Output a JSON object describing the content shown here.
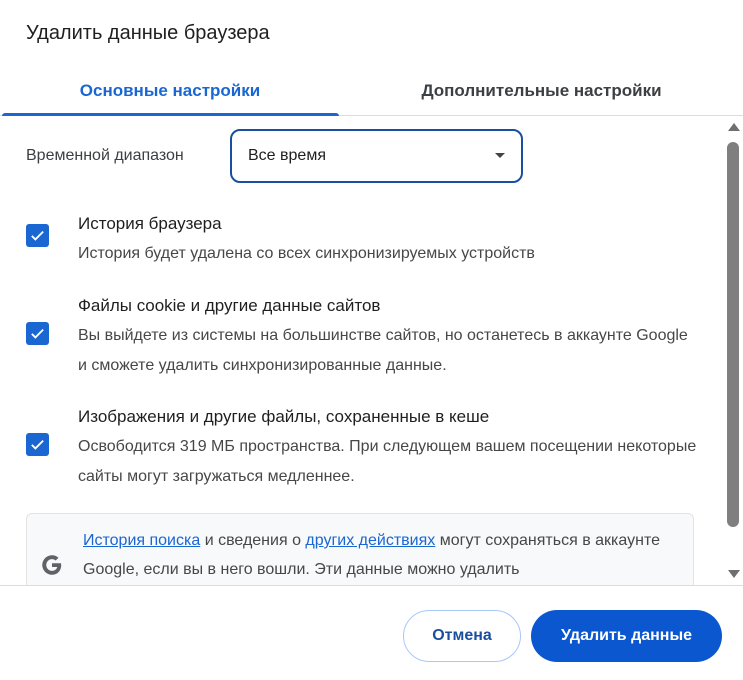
{
  "dialog": {
    "title": "Удалить данные браузера"
  },
  "tabs": [
    {
      "label": "Основные настройки",
      "active": true
    },
    {
      "label": "Дополнительные настройки",
      "active": false
    }
  ],
  "time_range": {
    "label": "Временной диапазон",
    "selected": "Все время"
  },
  "options": [
    {
      "title": "История браузера",
      "description": "История будет удалена со всех синхронизируемых устройств",
      "checked": true
    },
    {
      "title": "Файлы cookie и другие данные сайтов",
      "description": "Вы выйдете из системы на большинстве сайтов, но останетесь в аккаунте Google и сможете удалить синхронизированные данные.",
      "checked": true
    },
    {
      "title": "Изображения и другие файлы, сохраненные в кеше",
      "description": "Освободится 319 МБ пространства. При следующем вашем посещении некоторые сайты могут загружаться медленнее.",
      "checked": true
    }
  ],
  "info": {
    "link1": "История поиска",
    "text1": " и сведения о ",
    "link2": "других действиях",
    "text2": " могут сохраняться в аккаунте Google, если вы в него вошли. Эти данные можно удалить"
  },
  "buttons": {
    "cancel": "Отмена",
    "delete": "Удалить данные"
  },
  "colors": {
    "accent": "#1a67d2",
    "primary_button": "#0b57d0"
  }
}
